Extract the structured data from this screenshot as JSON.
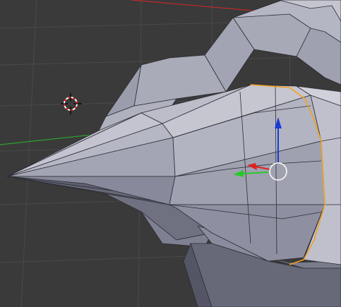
{
  "viewport": {
    "background": "#3a3a3a",
    "grid_color": "#4a4a4a",
    "x_axis_color": "#c02a2a",
    "y_axis_color": "#2ea02e"
  },
  "mesh": {
    "face_colors": [
      "#a9aab8",
      "#9c9eaf",
      "#8f91a3",
      "#b9bac6",
      "#c7c8d2",
      "#6c6e7e"
    ],
    "edge_color": "#2b2c33",
    "selection_color": "#f0a020"
  },
  "gizmo": {
    "z_color": "#1a3ad8",
    "x_color": "#e02020",
    "y_color": "#28c828",
    "ring_color": "#ffffff"
  },
  "cursor_3d": {
    "ring_colors": [
      "#ff2020",
      "#ffffff"
    ]
  }
}
